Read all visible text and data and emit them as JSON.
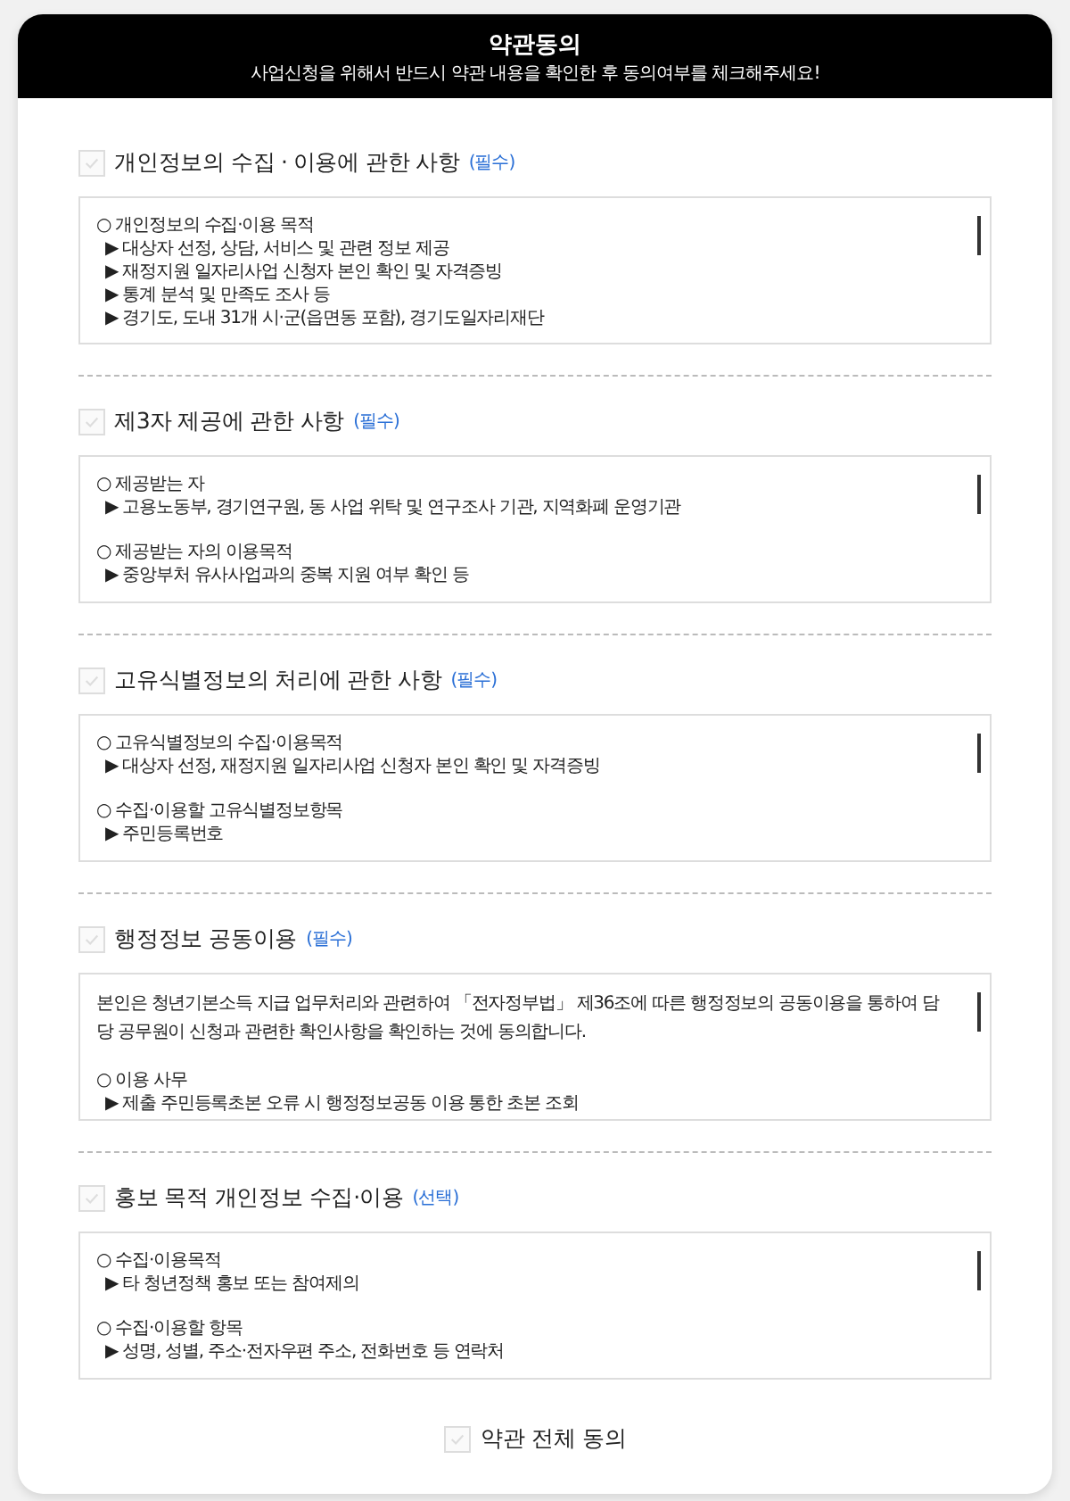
{
  "header": {
    "title": "약관동의",
    "subtitle": "사업신청을 위해서 반드시 약관 내용을 확인한 후 동의여부를 체크해주세요!"
  },
  "sections": [
    {
      "title": "개인정보의 수집 · 이용에 관한 사항",
      "tag": "(필수)",
      "checked": false,
      "groups": [
        {
          "lines": [
            {
              "kind": "heading",
              "text": "○ 개인정보의 수집·이용 목적"
            },
            {
              "kind": "item",
              "text": "▶ 대상자 선정, 상담, 서비스 및 관련 정보 제공"
            },
            {
              "kind": "item",
              "text": "▶ 재정지원 일자리사업 신청자 본인 확인 및 자격증빙"
            },
            {
              "kind": "item",
              "text": "▶ 통계 분석 및 만족도 조사 등"
            },
            {
              "kind": "item",
              "text": "▶ 경기도, 도내 31개 시·군(읍면동 포함), 경기도일자리재단"
            }
          ]
        }
      ]
    },
    {
      "title": "제3자 제공에 관한 사항",
      "tag": "(필수)",
      "checked": false,
      "groups": [
        {
          "lines": [
            {
              "kind": "heading",
              "text": "○ 제공받는 자"
            },
            {
              "kind": "item",
              "text": "▶ 고용노동부, 경기연구원, 동 사업 위탁 및 연구조사 기관, 지역화폐 운영기관"
            }
          ]
        },
        {
          "lines": [
            {
              "kind": "heading",
              "text": "○ 제공받는 자의 이용목적"
            },
            {
              "kind": "item",
              "text": "▶ 중앙부처 유사사업과의 중복 지원 여부 확인 등"
            }
          ]
        }
      ]
    },
    {
      "title": "고유식별정보의 처리에 관한 사항",
      "tag": "(필수)",
      "checked": false,
      "groups": [
        {
          "lines": [
            {
              "kind": "heading",
              "text": "○ 고유식별정보의 수집·이용목적"
            },
            {
              "kind": "item",
              "text": "▶ 대상자 선정, 재정지원 일자리사업 신청자 본인 확인 및 자격증빙"
            }
          ]
        },
        {
          "lines": [
            {
              "kind": "heading",
              "text": "○ 수집·이용할 고유식별정보항목"
            },
            {
              "kind": "item",
              "text": "▶ 주민등록번호"
            }
          ]
        }
      ]
    },
    {
      "title": "행정정보 공동이용",
      "tag": "(필수)",
      "checked": false,
      "groups": [
        {
          "lines": [
            {
              "kind": "para",
              "text": "본인은 청년기본소득 지급 업무처리와 관련하여 「전자정부법」 제36조에 따른 행정정보의 공동이용을 통하여 담당 공무원이 신청과 관련한 확인사항을 확인하는 것에 동의합니다."
            }
          ]
        },
        {
          "lines": [
            {
              "kind": "heading",
              "text": "○ 이용 사무"
            },
            {
              "kind": "item",
              "text": "▶ 제출 주민등록초본 오류 시 행정정보공동 이용 통한 초본 조회"
            }
          ]
        }
      ]
    },
    {
      "title": "홍보 목적 개인정보 수집·이용",
      "tag": "(선택)",
      "checked": false,
      "groups": [
        {
          "lines": [
            {
              "kind": "heading",
              "text": "○ 수집·이용목적"
            },
            {
              "kind": "item",
              "text": "▶ 타 청년정책 홍보 또는 참여제의"
            }
          ]
        },
        {
          "lines": [
            {
              "kind": "heading",
              "text": "○ 수집·이용할 항목"
            },
            {
              "kind": "item",
              "text": "▶ 성명, 성별, 주소·전자우편 주소, 전화번호 등 연락처"
            }
          ]
        }
      ]
    }
  ],
  "agree_all": {
    "label": "약관 전체 동의",
    "checked": false
  }
}
